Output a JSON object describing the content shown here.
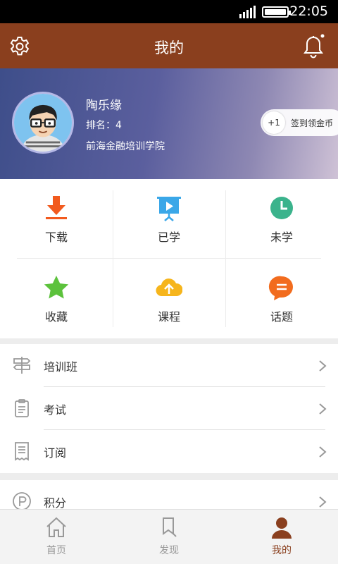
{
  "status": {
    "time": "22:05"
  },
  "header": {
    "title": "我的"
  },
  "profile": {
    "name": "陶乐缘",
    "rank": "排名：4",
    "school": "前海金融培训学院",
    "signin_badge": "+1",
    "signin_label": "签到领金币"
  },
  "grid": {
    "items": [
      {
        "label": "下载",
        "icon": "download-icon",
        "color": "#f25a1e"
      },
      {
        "label": "已学",
        "icon": "presentation-play-icon",
        "color": "#3aa7e8"
      },
      {
        "label": "未学",
        "icon": "clock-icon",
        "color": "#3bb38c"
      },
      {
        "label": "收藏",
        "icon": "star-icon",
        "color": "#5cc23c"
      },
      {
        "label": "课程",
        "icon": "cloud-upload-icon",
        "color": "#f6b51c"
      },
      {
        "label": "话题",
        "icon": "chat-bubble-icon",
        "color": "#f26c1e"
      }
    ]
  },
  "menu": {
    "items": [
      {
        "label": "培训班",
        "icon": "signpost-icon"
      },
      {
        "label": "考试",
        "icon": "clipboard-icon"
      },
      {
        "label": "订阅",
        "icon": "receipt-icon"
      },
      {
        "label": "积分",
        "icon": "points-icon"
      }
    ]
  },
  "tabbar": {
    "tabs": [
      {
        "label": "首页",
        "icon": "home-icon",
        "active": false
      },
      {
        "label": "发现",
        "icon": "bookmark-icon",
        "active": false
      },
      {
        "label": "我的",
        "icon": "user-icon",
        "active": true
      }
    ]
  },
  "colors": {
    "brand": "#8a3f1e",
    "inactive_tab": "#999999"
  }
}
